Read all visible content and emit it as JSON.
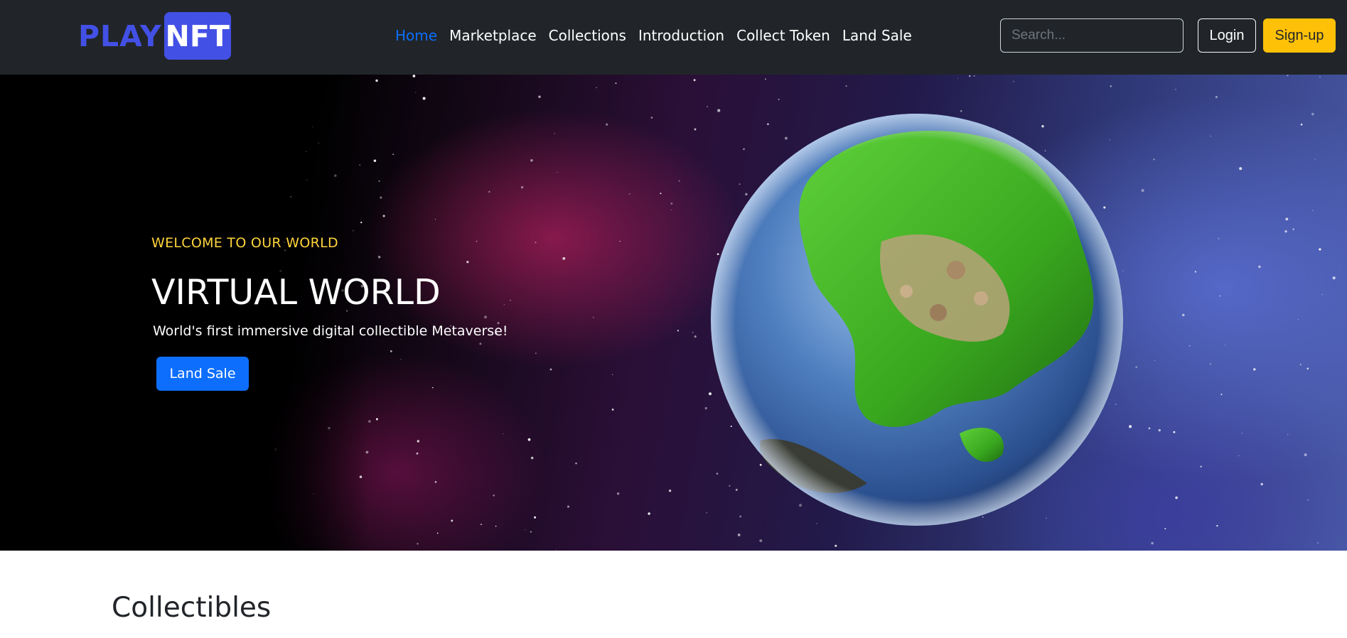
{
  "brand": {
    "part1": "PLAY",
    "part2": "NFT"
  },
  "nav": {
    "items": [
      {
        "label": "Home",
        "active": true
      },
      {
        "label": "Marketplace",
        "active": false
      },
      {
        "label": "Collections",
        "active": false
      },
      {
        "label": "Introduction",
        "active": false
      },
      {
        "label": "Collect Token",
        "active": false
      },
      {
        "label": "Land Sale",
        "active": false
      }
    ],
    "search_placeholder": "Search...",
    "login_label": "Login",
    "signup_label": "Sign-up"
  },
  "hero": {
    "eyebrow": "WELCOME TO OUR WORLD",
    "title": "VIRTUAL WORLD",
    "subtitle": "World's first immersive digital collectible Metaverse!",
    "cta_label": "Land Sale"
  },
  "section": {
    "title": "Collectibles"
  },
  "colors": {
    "navbar_bg": "#212529",
    "brand_blue": "#4350e6",
    "active_link": "#0d6efd",
    "eyebrow": "#ffd43b",
    "signup_bg": "#ffc107",
    "cta_bg": "#0d6efd"
  }
}
